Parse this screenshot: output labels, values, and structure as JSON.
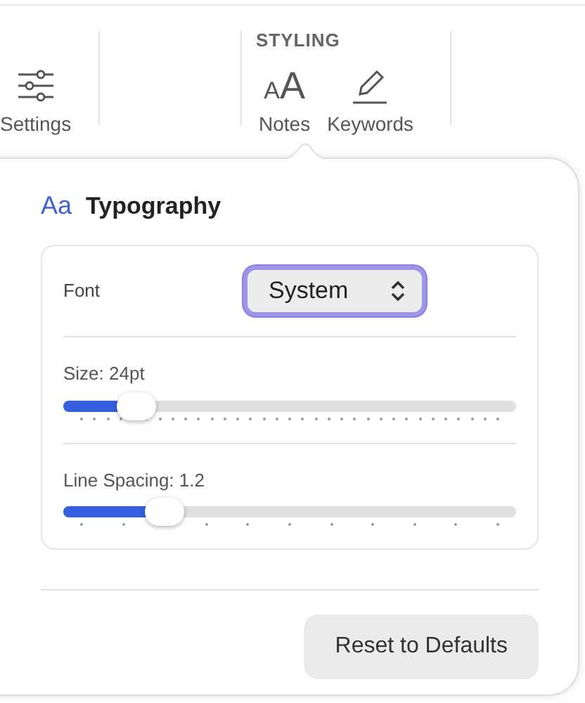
{
  "toolbar": {
    "groups": [
      {
        "items": [
          {
            "kind": "settings",
            "label": "Settings"
          }
        ]
      },
      {
        "label": "STYLING",
        "items": [
          {
            "kind": "notes",
            "glyph": "AA",
            "label": "Notes"
          },
          {
            "kind": "keywords",
            "label": "Keywords"
          }
        ]
      }
    ]
  },
  "popover": {
    "icon_text": "Aa",
    "title": "Typography",
    "font": {
      "label": "Font",
      "value": "System",
      "focused": true
    },
    "sliders": [
      {
        "label": "Size: 24pt",
        "level": 0.16,
        "kind": "fine"
      },
      {
        "label": "Line Spacing: 1.2",
        "level": 0.225,
        "kind": "coarse"
      }
    ],
    "reset_button": "Reset to Defaults"
  }
}
